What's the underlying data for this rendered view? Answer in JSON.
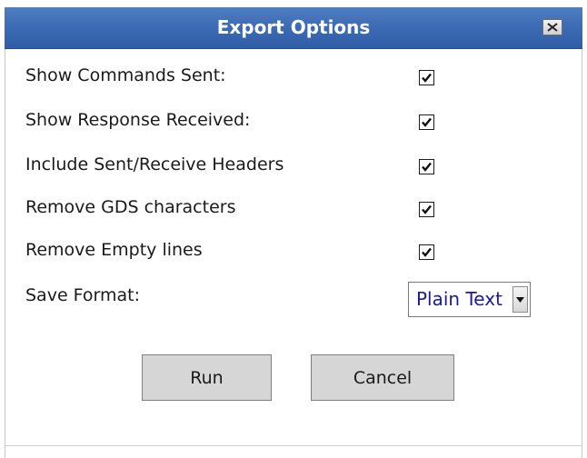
{
  "dialog": {
    "title": "Export Options",
    "close_icon": "close-icon"
  },
  "options": [
    {
      "label": "Show Commands Sent:",
      "checked": true
    },
    {
      "label": "Show Response Received:",
      "checked": true
    },
    {
      "label": "Include Sent/Receive Headers",
      "checked": true
    },
    {
      "label": "Remove GDS characters",
      "checked": true
    },
    {
      "label": "Remove Empty lines",
      "checked": true
    }
  ],
  "save_format": {
    "label": "Save Format:",
    "selected": "Plain Text"
  },
  "buttons": {
    "run": "Run",
    "cancel": "Cancel"
  },
  "colors": {
    "titlebar": "#3c6ab3",
    "title_text": "#ffffff",
    "select_text": "#1a1aa0",
    "button_bg": "#d6d6d6"
  }
}
